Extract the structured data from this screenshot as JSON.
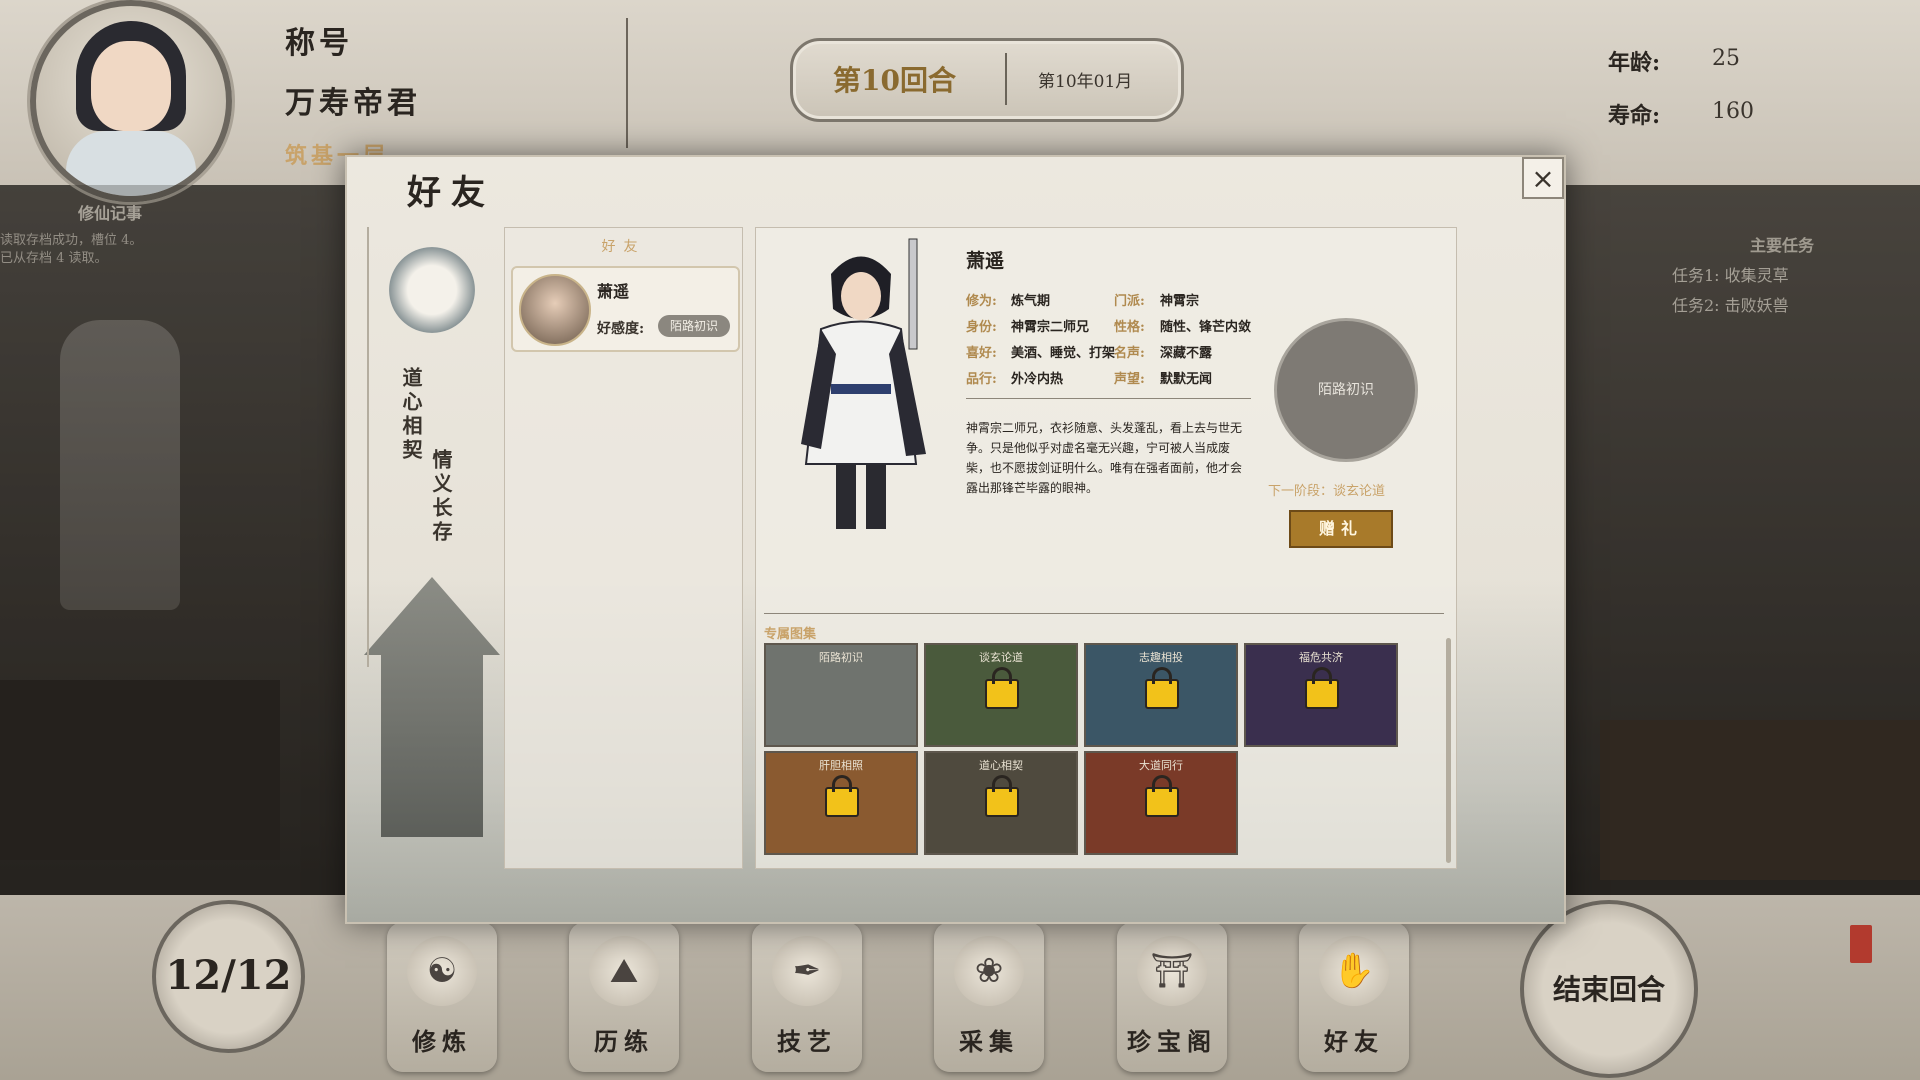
{
  "hud": {
    "title_label": "称号",
    "title_value": "万寿帝君",
    "realm": "筑基一层",
    "journal_label": "修仙记事",
    "log_lines": [
      "读取存档成功，槽位 4。",
      "已从存档 4 读取。"
    ],
    "round_main": "第10回合",
    "round_sub": "第10年01月",
    "age_label": "年龄:",
    "age_value": "25",
    "life_label": "寿命:",
    "life_value": "160"
  },
  "quests": {
    "title": "主要任务",
    "items": [
      "任务1: 收集灵草",
      "任务2: 击败妖兽"
    ]
  },
  "bottom": {
    "turns": "12/12",
    "nav": [
      {
        "label": "修炼",
        "icon": "meditate-icon",
        "glyph": "☯"
      },
      {
        "label": "历练",
        "icon": "mountain-icon",
        "glyph": "⛰"
      },
      {
        "label": "技艺",
        "icon": "brush-icon",
        "glyph": "✒"
      },
      {
        "label": "采集",
        "icon": "herb-icon",
        "glyph": "❀"
      },
      {
        "label": "珍宝阁",
        "icon": "pavilion-icon",
        "glyph": "⛩"
      },
      {
        "label": "好友",
        "icon": "handshake-icon",
        "glyph": "✋"
      }
    ],
    "end_turn": "结束回合"
  },
  "modal": {
    "title": "好友",
    "vertical_1": "道心相契",
    "vertical_2": "情义长存",
    "list_title": "好友",
    "friend": {
      "name": "萧遥",
      "favor_label": "好感度:",
      "favor_badge": "陌路初识"
    },
    "detail": {
      "name": "萧遥",
      "rows_left": [
        {
          "k": "修为:",
          "v": "炼气期"
        },
        {
          "k": "身份:",
          "v": "神霄宗二师兄"
        },
        {
          "k": "喜好:",
          "v": "美酒、睡觉、打架"
        },
        {
          "k": "品行:",
          "v": "外冷内热"
        }
      ],
      "rows_right": [
        {
          "k": "门派:",
          "v": "神霄宗"
        },
        {
          "k": "性格:",
          "v": "随性、锋芒内敛"
        },
        {
          "k": "名声:",
          "v": "深藏不露"
        },
        {
          "k": "声望:",
          "v": "默默无闻"
        }
      ],
      "description": "神霄宗二师兄，衣衫随意、头发蓬乱，看上去与世无争。只是他似乎对虚名毫无兴趣，宁可被人当成废柴，也不愿拔剑证明什么。唯有在强者面前，他才会露出那锋芒毕露的眼神。",
      "stage": "陌路初识",
      "next_stage": "下一阶段：谈玄论道",
      "gift": "赠礼",
      "cg_title": "专属图集",
      "cgs": [
        {
          "title": "陌路初识",
          "locked": false,
          "color": "#6f736e"
        },
        {
          "title": "谈玄论道",
          "locked": true,
          "color": "#4a5a3c"
        },
        {
          "title": "志趣相投",
          "locked": true,
          "color": "#3b5666"
        },
        {
          "title": "福危共济",
          "locked": true,
          "color": "#3a2f4e"
        },
        {
          "title": "肝胆相照",
          "locked": true,
          "color": "#8a5a30"
        },
        {
          "title": "道心相契",
          "locked": true,
          "color": "#4f4a3e"
        },
        {
          "title": "大道同行",
          "locked": true,
          "color": "#7a3a28"
        }
      ]
    }
  }
}
